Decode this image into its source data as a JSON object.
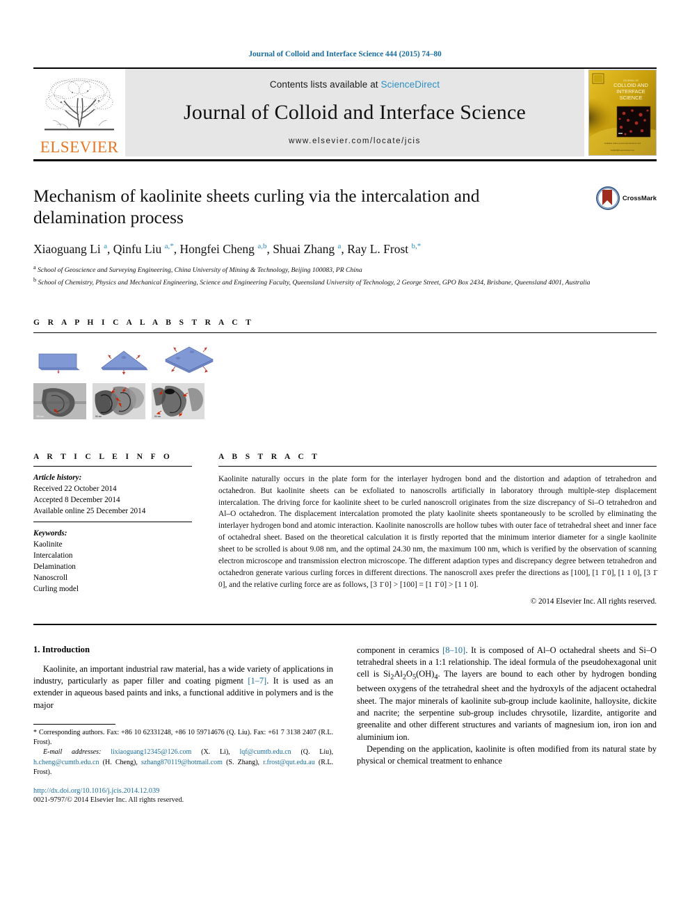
{
  "running_head": "Journal of Colloid and Interface Science 444 (2015) 74–80",
  "masthead": {
    "publisher": "ELSEVIER",
    "contents_prefix": "Contents lists available at ",
    "contents_link": "ScienceDirect",
    "journal_title": "Journal of Colloid and Interface Science",
    "journal_url": "www.elsevier.com/locate/jcis",
    "cover_title_small": "JOURNAL OF",
    "cover_title": "COLLOID AND INTERFACE SCIENCE"
  },
  "article": {
    "title": "Mechanism of kaolinite sheets curling via the intercalation and delamination process",
    "crossmark_label": "CrossMark",
    "authors_html": "Xiaoguang Li <sup>a</sup>, Qinfu Liu <sup>a,*</sup>, Hongfei Cheng <sup>a,b</sup>, Shuai Zhang <sup>a</sup>, Ray L. Frost <sup>b,*</sup>",
    "affiliations": [
      "School of Geoscience and Surveying Engineering, China University of Mining & Technology, Beijing 100083, PR China",
      "School of Chemistry, Physics and Mechanical Engineering, Science and Engineering Faculty, Queensland University of Technology, 2 George Street, GPO Box 2434, Brisbane, Queensland 4001, Australia"
    ],
    "affiliation_marks": [
      "a",
      "b"
    ]
  },
  "graphical_abstract": {
    "heading": "G R A P H I C A L   A B S T R A C T"
  },
  "article_info": {
    "heading": "A R T I C L E   I N F O",
    "history_label": "Article history:",
    "history": [
      "Received 22 October 2014",
      "Accepted 8 December 2014",
      "Available online 25 December 2014"
    ],
    "keywords_label": "Keywords:",
    "keywords": [
      "Kaolinite",
      "Intercalation",
      "Delamination",
      "Nanoscroll",
      "Curling model"
    ]
  },
  "abstract": {
    "heading": "A B S T R A C T",
    "text": "Kaolinite naturally occurs in the plate form for the interlayer hydrogen bond and the distortion and adaption of tetrahedron and octahedron. But kaolinite sheets can be exfoliated to nanoscrolls artificially in laboratory through multiple-step displacement intercalation. The driving force for kaolinite sheet to be curled nanoscroll originates from the size discrepancy of Si–O tetrahedron and Al–O octahedron. The displacement intercalation promoted the platy kaolinite sheets spontaneously to be scrolled by eliminating the interlayer hydrogen bond and atomic interaction. Kaolinite nanoscrolls are hollow tubes with outer face of tetrahedral sheet and inner face of octahedral sheet. Based on the theoretical calculation it is firstly reported that the minimum interior diameter for a single kaolinite sheet to be scrolled is about 9.08 nm, and the optimal 24.30 nm, the maximum 100 nm, which is verified by the observation of scanning electron microscope and transmission electron microscope. The different adaption types and discrepancy degree between tetrahedron and octahedron generate various curling forces in different directions. The nanoscroll axes prefer the directions as [100], [1 1̄ 0], [1 1 0], [3 1̄ 0], and the relative curling force are as follows, [3 1̄ 0] > [100] = [1 1̄ 0] > [1 1 0].",
    "copyright": "© 2014 Elsevier Inc. All rights reserved."
  },
  "introduction": {
    "heading": "1. Introduction",
    "left_para_1_part1": "Kaolinite, an important industrial raw material, has a wide variety of applications in industry, particularly as paper filler and coating pigment ",
    "left_ref_1": "[1–7]",
    "left_para_1_part2": ". It is used as an extender in aqueous based paints and inks, a functional additive in polymers and is the major",
    "right_para_1_part1": "component in ceramics ",
    "right_ref_1": "[8–10]",
    "right_para_1_part2": ". It is composed of Al–O octahedral sheets and Si–O tetrahedral sheets in a 1:1 relationship. The ideal formula of the pseudohexagonal unit cell is Si2Al2O5(OH)4. The layers are bound to each other by hydrogen bonding between oxygens of the tetrahedral sheet and the hydroxyls of the adjacent octahedral sheet. The major minerals of kaolinite sub-group include kaolinite, halloysite, dickite and nacrite; the serpentine sub-group includes chrysotile, lizardite, antigorite and greenalite and other different structures and variants of magnesium ion, iron ion and aluminium ion.",
    "right_para_2": "Depending on the application, kaolinite is often modified from its natural state by physical or chemical treatment to enhance"
  },
  "footnote": {
    "corresponding": "* Corresponding authors. Fax: +86 10 62331248, +86 10 59714676 (Q. Liu). Fax: +61 7 3138 2407 (R.L. Frost).",
    "email_label": "E-mail addresses:",
    "emails": [
      {
        "addr": "lixiaoguang12345@126.com",
        "who": " (X. Li), "
      },
      {
        "addr": "lqf@cumtb.edu.cn",
        "who": " (Q. Liu), "
      },
      {
        "addr": "h.cheng@cumtb.edu.cn",
        "who": " (H. Cheng), "
      },
      {
        "addr": "szhang870119@hotmail.com",
        "who": " (S. Zhang), "
      },
      {
        "addr": "r.frost@qut.edu.au",
        "who": " (R.L. Frost)."
      }
    ],
    "doi": "http://dx.doi.org/10.1016/j.jcis.2014.12.039",
    "issn": "0021-9797/© 2014 Elsevier Inc. All rights reserved."
  },
  "colors": {
    "link": "#1a6e9e",
    "sciencedirect": "#2b8fc4",
    "elsevier_orange": "#E87722",
    "box_gray": "#e6e6e6",
    "diagram_blue": "#7f95d1"
  }
}
